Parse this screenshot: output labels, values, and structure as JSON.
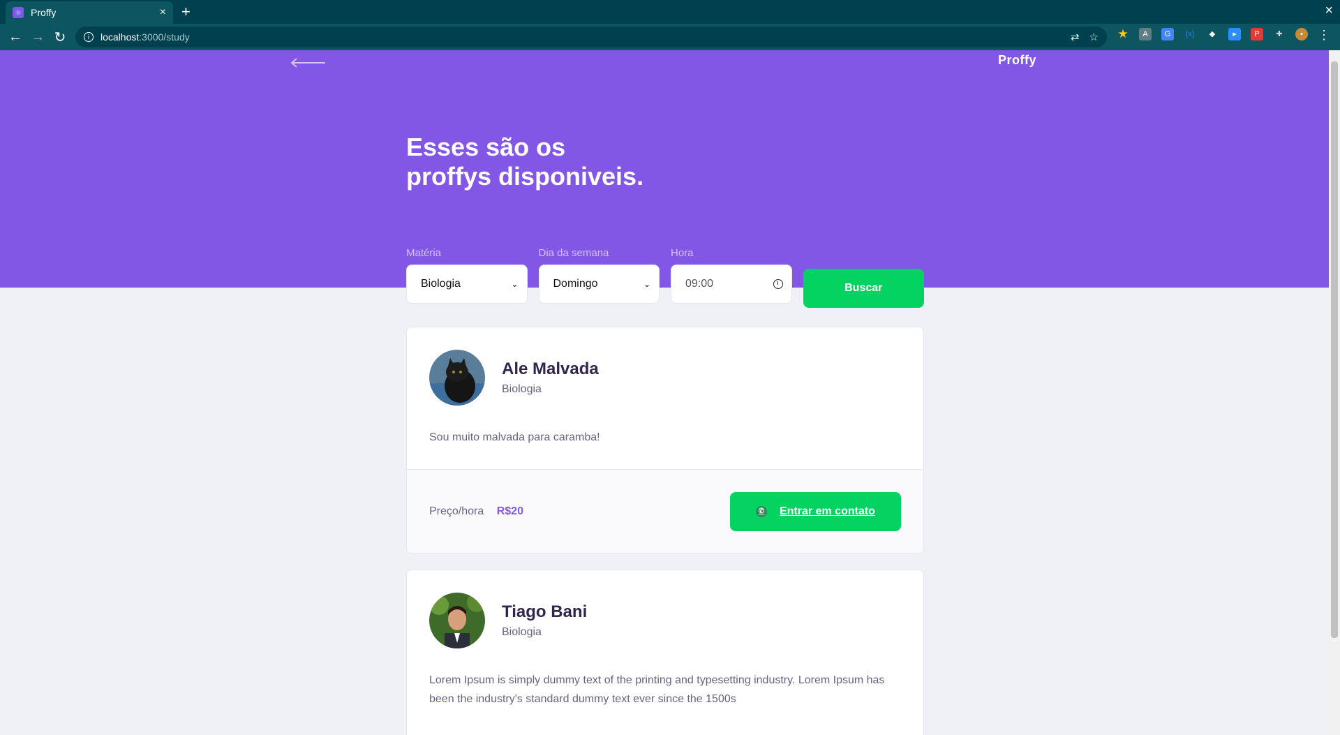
{
  "browser": {
    "tab_title": "Proffy",
    "url_host": "localhost",
    "url_path": ":3000/study"
  },
  "header": {
    "logo": "Proffy",
    "headline_line1": "Esses são os",
    "headline_line2": "proffys disponiveis."
  },
  "filters": {
    "subject_label": "Matéria",
    "subject_value": "Biologia",
    "weekday_label": "Dia da semana",
    "weekday_value": "Domingo",
    "time_label": "Hora",
    "time_value": "09:00",
    "search_label": "Buscar"
  },
  "teachers": [
    {
      "name": "Ale Malvada",
      "subject": "Biologia",
      "bio": "Sou muito malvada para caramba!",
      "price_label": "Preço/hora",
      "price": "R$20",
      "contact_label": "Entrar em contato"
    },
    {
      "name": "Tiago Bani",
      "subject": "Biologia",
      "bio": "Lorem Ipsum is simply dummy text of the printing and typesetting industry. Lorem Ipsum has been the industry's standard dummy text ever since the 1500s"
    }
  ],
  "colors": {
    "primary": "#8257e5",
    "secondary": "#04d361",
    "background": "#f0f0f7",
    "title": "#32264d",
    "text": "#6a6180"
  }
}
